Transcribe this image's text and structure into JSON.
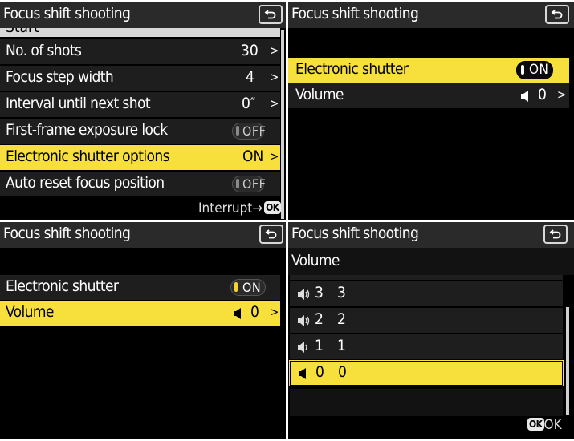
{
  "panel_a": {
    "title": "Focus shift shooting",
    "partial_top_label": "Start",
    "rows": [
      {
        "label": "No. of shots",
        "value": "30"
      },
      {
        "label": "Focus step width",
        "value": "4"
      },
      {
        "label": "Interval until next shot",
        "value": "0″"
      },
      {
        "label": "First-frame exposure lock",
        "value": "OFF"
      },
      {
        "label": "Electronic shutter options",
        "value": "ON"
      },
      {
        "label": "Auto reset focus position",
        "value": "OFF"
      }
    ],
    "footer_text": "Interrupt→",
    "footer_ok": "OK"
  },
  "panel_b": {
    "title": "Focus shift shooting",
    "rows": [
      {
        "label": "Electronic shutter",
        "value": "ON"
      },
      {
        "label": "Volume",
        "value": "0"
      }
    ]
  },
  "panel_c": {
    "title": "Focus shift shooting",
    "rows": [
      {
        "label": "Electronic shutter",
        "value": "ON"
      },
      {
        "label": "Volume",
        "value": "0"
      }
    ]
  },
  "panel_d": {
    "title": "Focus shift shooting",
    "subtitle": "Volume",
    "options": [
      {
        "level": "3",
        "value": "3"
      },
      {
        "level": "2",
        "value": "2"
      },
      {
        "level": "1",
        "value": "1"
      },
      {
        "level": "0",
        "value": "0"
      }
    ],
    "footer_ok": "OK",
    "footer_text": "OK"
  },
  "colors": {
    "highlight": "#f8e03c",
    "row_bg": "#1e1e1e",
    "title_bg": "#2a2a2a"
  }
}
